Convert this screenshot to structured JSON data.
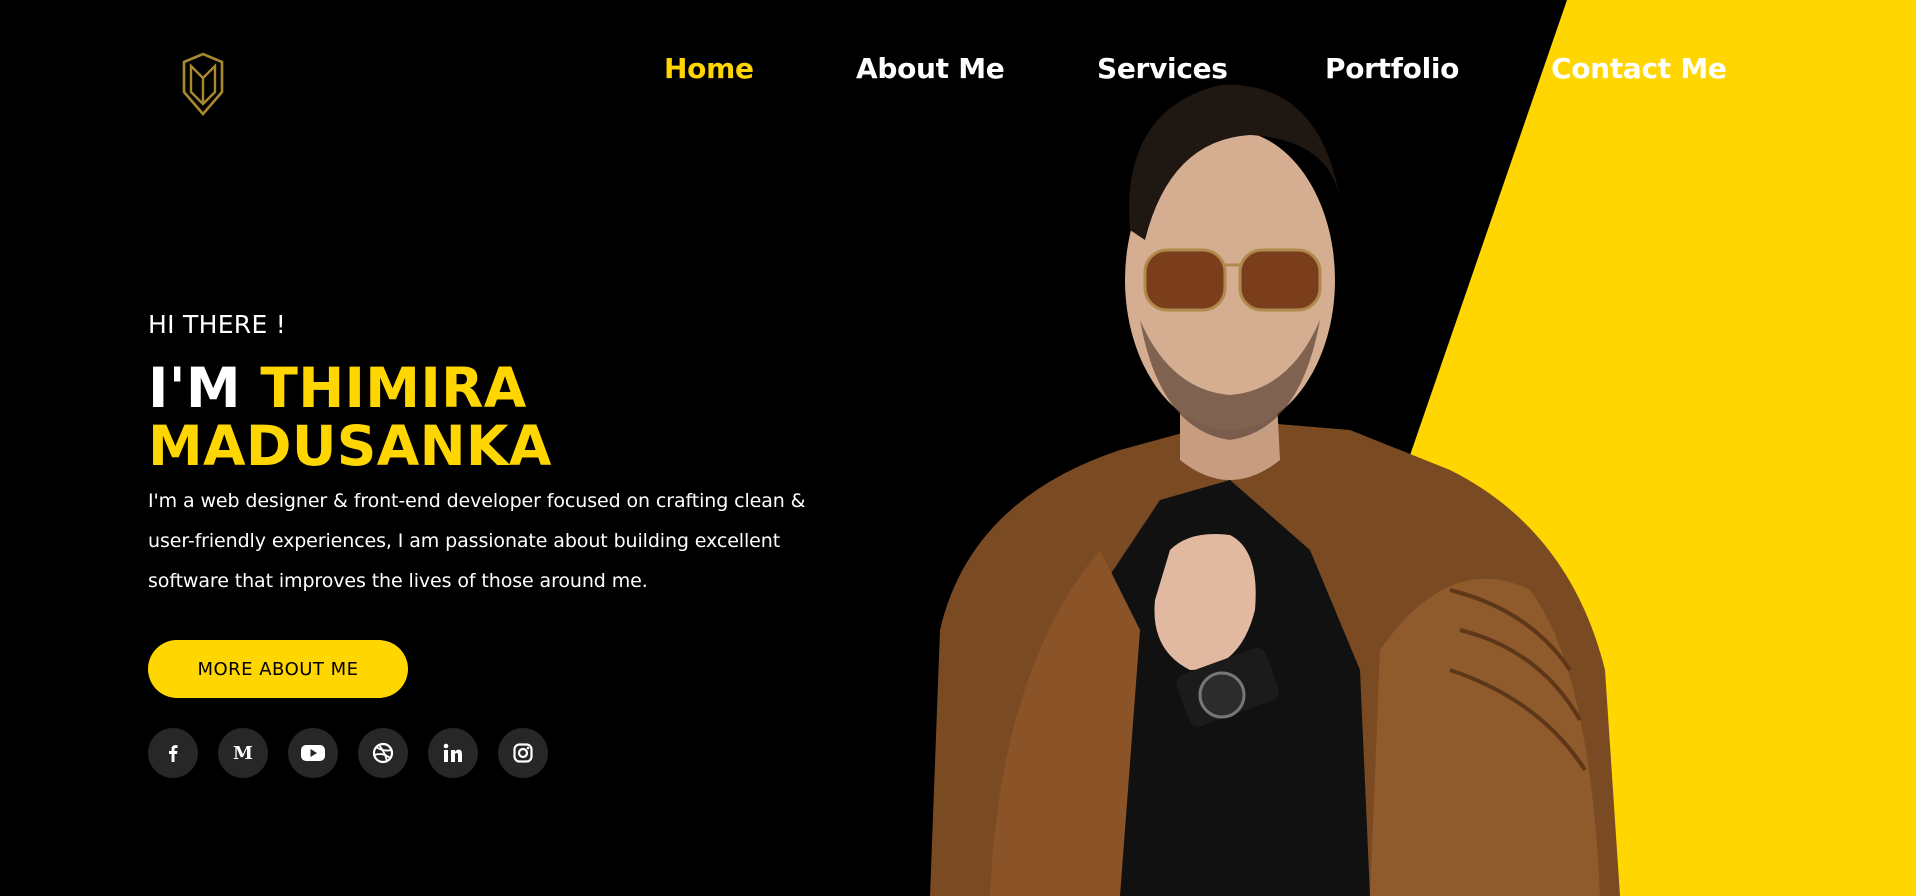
{
  "colors": {
    "accent": "#ffd600",
    "background": "#000000",
    "social_bg": "#272727"
  },
  "logo": {
    "icon": "monogram-logo-icon"
  },
  "nav": {
    "items": [
      {
        "label": "Home",
        "active": true
      },
      {
        "label": "About Me",
        "active": false
      },
      {
        "label": "Services",
        "active": false
      },
      {
        "label": "Portfolio",
        "active": false
      },
      {
        "label": "Contact Me",
        "active": false
      }
    ]
  },
  "hero": {
    "greeting": "HI THERE !",
    "name_prefix": "I'M ",
    "name_highlight": "THIMIRA MADUSANKA",
    "description": "I'm a web designer & front-end developer focused on crafting clean & user-friendly experiences, I am passionate about building excellent software that improves the lives of those around me.",
    "cta_label": "MORE ABOUT ME"
  },
  "socials": [
    {
      "icon": "facebook-icon"
    },
    {
      "icon": "medium-icon"
    },
    {
      "icon": "youtube-icon"
    },
    {
      "icon": "dribbble-icon"
    },
    {
      "icon": "linkedin-icon"
    },
    {
      "icon": "instagram-icon"
    }
  ]
}
